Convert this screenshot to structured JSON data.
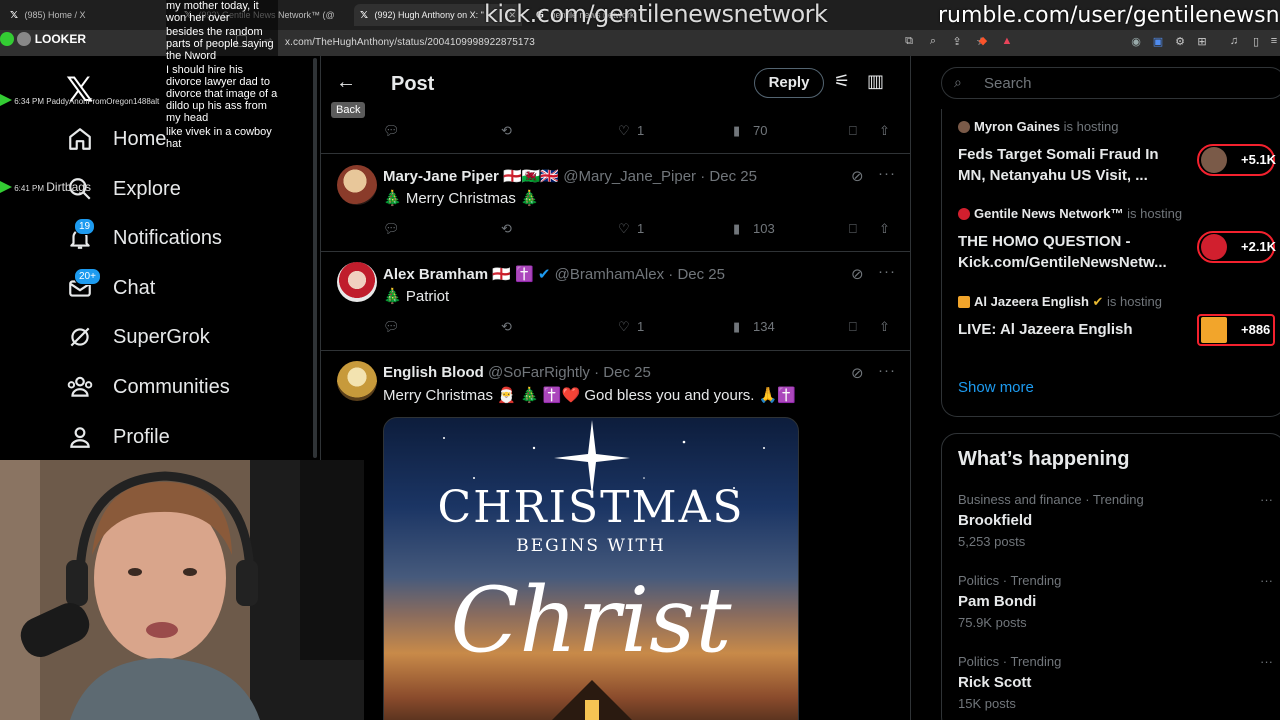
{
  "browser": {
    "tabs": [
      {
        "label": "(985) Home / X",
        "active": false
      },
      {
        "label": "(992) Gentile News Network™ (@",
        "active": false
      },
      {
        "label": "(992) Hugh Anthony on X: \"",
        "active": true
      },
      {
        "label": "gentile news network",
        "active": false
      }
    ],
    "url": "x.com/TheHughAnthony/status/2004109998922875173"
  },
  "overlays": {
    "kick_url": "kick.com/gentilenewsnetwork",
    "rumble_url": "rumble.com/user/gentilenewsnet",
    "looker_label": "LOOKER",
    "viewer_rows": [
      {
        "time": "6:34 PM",
        "text": "PaddyAnonFromOregon1488alt"
      },
      {
        "time": "6:41 PM",
        "text": "Dirtbags"
      }
    ],
    "chat_messages": [
      "my mother today, it won her over",
      "besides the random parts of people saying the Nword",
      "I should hire his divorce lawyer dad to divorce that image of a dildo up his ass from my head",
      "like vivek in a cowboy hat"
    ]
  },
  "sidebar": {
    "items": [
      {
        "label": "Home",
        "icon": "home-icon"
      },
      {
        "label": "Explore",
        "icon": "search-icon"
      },
      {
        "label": "Notifications",
        "icon": "bell-icon",
        "badge": "19"
      },
      {
        "label": "Chat",
        "icon": "mail-icon",
        "badge": "20+"
      },
      {
        "label": "SuperGrok",
        "icon": "grok-icon"
      },
      {
        "label": "Communities",
        "icon": "communities-icon"
      },
      {
        "label": "Profile",
        "icon": "profile-icon"
      }
    ]
  },
  "post_header": {
    "title": "Post",
    "back_tooltip": "Back",
    "reply_label": "Reply"
  },
  "top_action_row": {
    "likes": "1",
    "views": "70"
  },
  "tweets": [
    {
      "name": "Mary-Jane Piper",
      "flags": "🏴󠁧󠁢󠁥󠁮󠁧󠁿🏴󠁧󠁢󠁷󠁬󠁳󠁿🇬🇧",
      "handle": "@Mary_Jane_Piper",
      "date": "Dec 25",
      "text": "🎄 Merry Christmas 🎄",
      "likes": "1",
      "views": "103"
    },
    {
      "name": "Alex Bramham",
      "flags": "🏴󠁧󠁢󠁥󠁮󠁧󠁿 ✝️",
      "handle": "@BramhamAlex",
      "date": "Dec 25",
      "text": "🎄 Patriot",
      "likes": "1",
      "views": "134"
    },
    {
      "name": "English Blood",
      "flags": "",
      "handle": "@SoFarRightly",
      "date": "Dec 25",
      "text": "Merry Christmas 🎅 🎄 ✝️❤️ God bless you and yours. 🙏✝️"
    }
  ],
  "tweet_image": {
    "line1": "CHRISTMAS",
    "line2": "BEGINS WITH",
    "line3": "Christ"
  },
  "right": {
    "search_placeholder": "Search",
    "live": [
      {
        "host": "Myron Gaines",
        "is_hosting": "is hosting",
        "title": "Feds Target Somali Fraud In MN, Netanyahu US Visit, ...",
        "count": "+5.1K",
        "color": "#7a5a48"
      },
      {
        "host": "Gentile News Network™",
        "is_hosting": "is hosting",
        "title": "THE HOMO QUESTION - Kick.com/GentileNewsNetw...",
        "count": "+2.1K",
        "color": "#d11f2e"
      },
      {
        "host": "Al Jazeera English",
        "is_hosting": "is hosting",
        "title": "LIVE: Al Jazeera English",
        "count": "+886",
        "color": "#f2a52b"
      }
    ],
    "show_more": "Show more",
    "happening_title": "What’s happening",
    "trends": [
      {
        "category": "Business and finance · Trending",
        "name": "Brookfield",
        "count": "5,253 posts"
      },
      {
        "category": "Politics · Trending",
        "name": "Pam Bondi",
        "count": "75.9K posts"
      },
      {
        "category": "Politics · Trending",
        "name": "Rick Scott",
        "count": "15K posts"
      }
    ]
  },
  "colors": {
    "accent": "#1d9bf0",
    "live_ring": "#f4212e",
    "border": "#2f3336",
    "muted_text": "#71767b"
  }
}
